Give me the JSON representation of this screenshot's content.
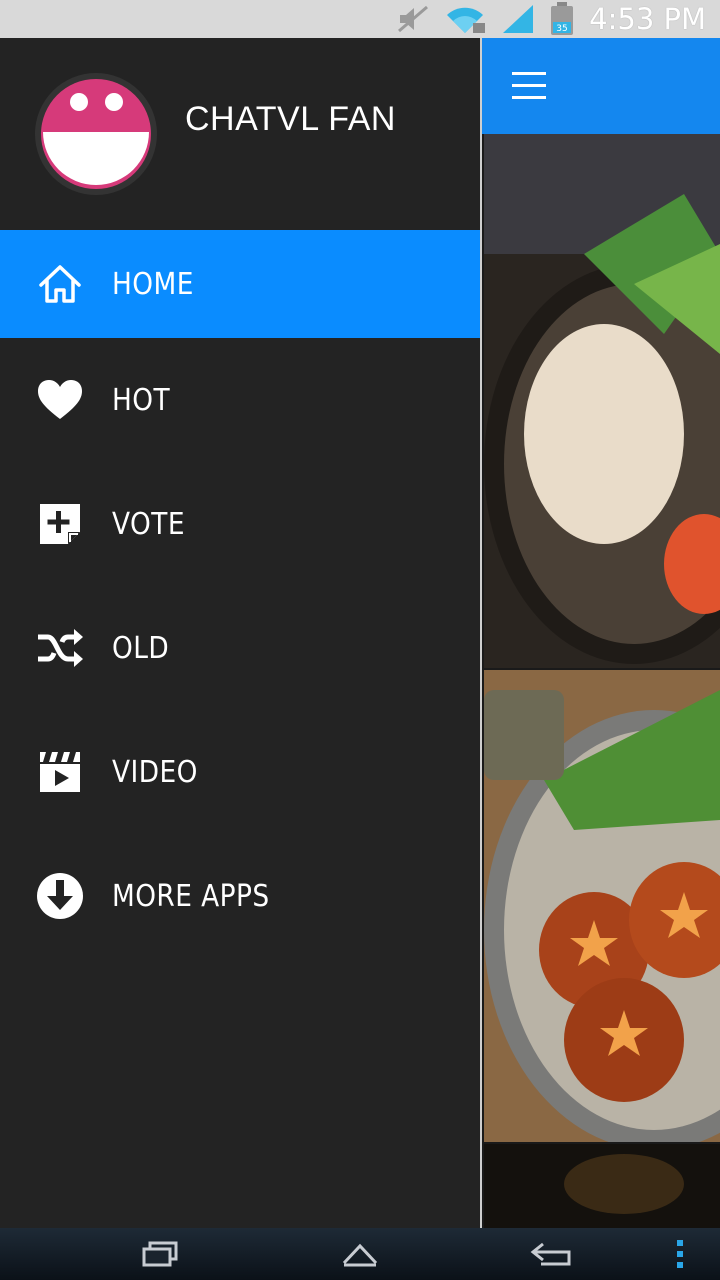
{
  "status_bar": {
    "time": "4:53 PM",
    "icons": [
      "mute-icon",
      "wifi-icon",
      "signal-icon",
      "battery-icon"
    ],
    "battery_label": "35"
  },
  "app_bar": {
    "color": "#1487ef",
    "menu_icon": "hamburger-icon"
  },
  "drawer": {
    "background": "#232323",
    "profile": {
      "name": "CHATVL FAN",
      "avatar_colors": {
        "top": "#d63a7a",
        "bottom": "#ffffff"
      }
    },
    "accent": "#0a8cff",
    "items": [
      {
        "label": "HOME",
        "icon": "home-icon",
        "active": true
      },
      {
        "label": "HOT",
        "icon": "heart-icon",
        "active": false
      },
      {
        "label": "VOTE",
        "icon": "add-note-icon",
        "active": false
      },
      {
        "label": "OLD",
        "icon": "shuffle-icon",
        "active": false
      },
      {
        "label": "VIDEO",
        "icon": "clapperboard-icon",
        "active": false
      },
      {
        "label": "MORE APPS",
        "icon": "download-icon",
        "active": false
      }
    ]
  },
  "feed": {
    "images": [
      "hotpot-photo",
      "dragon-ball-hotpot-photo",
      "dark-photo"
    ]
  },
  "nav_bar": {
    "buttons": [
      "recent-apps-icon",
      "home-nav-icon",
      "back-icon",
      "overflow-menu-icon"
    ]
  }
}
